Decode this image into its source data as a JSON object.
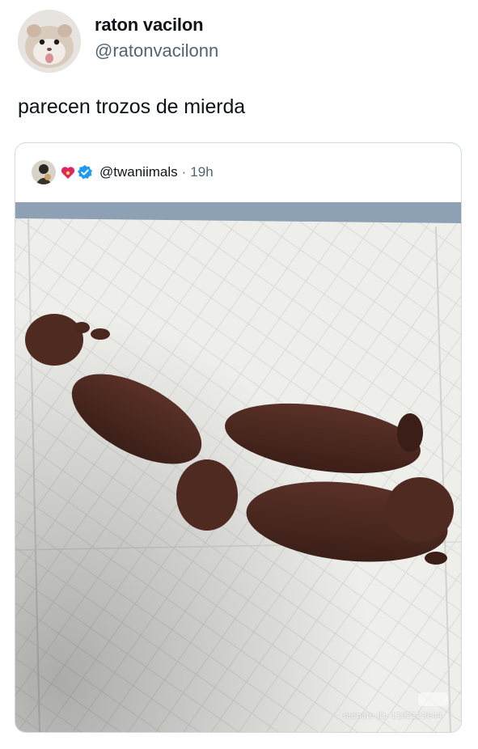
{
  "post": {
    "display_name": "raton vacilon",
    "handle": "@ratonvacilonn",
    "text": "parecen trozos de mierda",
    "avatar_icon": "hamster-avatar"
  },
  "quoted": {
    "handle": "@twaniimals",
    "separator": "·",
    "time": "19h",
    "avatar_icon": "profile-avatar",
    "badges": [
      "heart-emoji-icon",
      "verified-badge-icon"
    ],
    "verified_color": "#1d9bf0"
  },
  "photo": {
    "subject": "three-brown-puppies-on-white-pad",
    "watermark_logo": "小红书",
    "watermark_id": "rednote ID: 1182123644"
  },
  "colors": {
    "text": "#0f1419",
    "secondary": "#536471",
    "border": "#cfd9de"
  }
}
